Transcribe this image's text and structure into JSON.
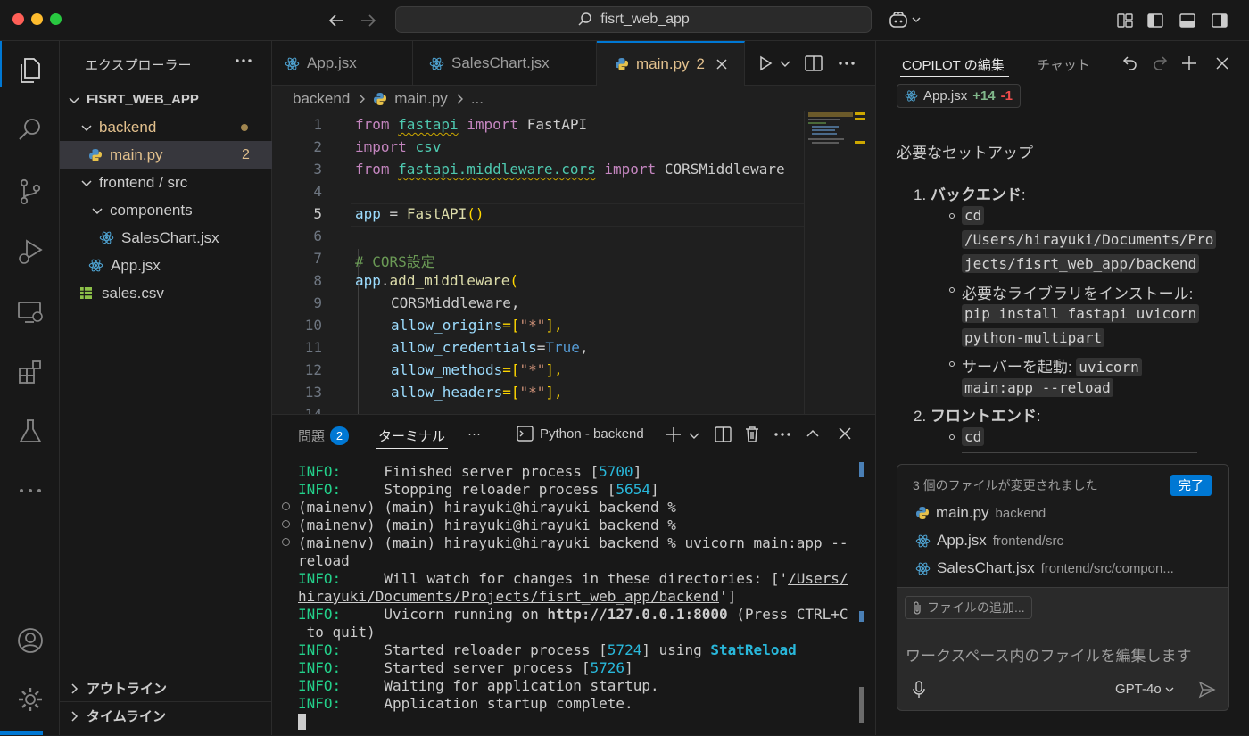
{
  "window": {
    "search_text": "fisrt_web_app"
  },
  "explorer": {
    "title": "エクスプローラー",
    "root": "FISRT_WEB_APP",
    "items": [
      {
        "label": "backend"
      },
      {
        "label": "main.py",
        "badge": "2"
      },
      {
        "label": "frontend / src"
      },
      {
        "label": "components"
      },
      {
        "label": "SalesChart.jsx"
      },
      {
        "label": "App.jsx"
      },
      {
        "label": "sales.csv"
      }
    ],
    "outline": "アウトライン",
    "timeline": "タイムライン"
  },
  "editor": {
    "tabs": [
      {
        "label": "App.jsx"
      },
      {
        "label": "SalesChart.jsx"
      },
      {
        "label": "main.py",
        "badge": "2"
      }
    ],
    "breadcrumb": [
      "backend",
      "main.py",
      "..."
    ],
    "line_numbers": [
      "1",
      "2",
      "3",
      "4",
      "5",
      "6",
      "7",
      "8",
      "9",
      "10",
      "11",
      "12",
      "13"
    ],
    "code": {
      "l1": [
        "from",
        "fastapi",
        "import",
        "FastAPI"
      ],
      "l2": [
        "import",
        "csv"
      ],
      "l3": [
        "from",
        "fastapi.middleware.cors",
        "import",
        "CORSMiddleware"
      ],
      "l5": [
        "app",
        " = ",
        "FastAPI",
        "()"
      ],
      "l7": "# CORS設定",
      "l8": [
        "app",
        ".",
        "add_middleware",
        "("
      ],
      "l9": "CORSMiddleware,",
      "l10": [
        "allow_origins",
        "=[",
        "\"*\"",
        "],"
      ],
      "l11": [
        "allow_credentials",
        "=",
        "True",
        ","
      ],
      "l12": [
        "allow_methods",
        "=[",
        "\"*\"",
        "],"
      ],
      "l13": [
        "allow_headers",
        "=[",
        "\"*\"",
        "],"
      ]
    }
  },
  "panel": {
    "problems_label": "問題",
    "problems_count": "2",
    "terminal_label": "ターミナル",
    "more": "···",
    "shell_label": "Python - backend",
    "lines": {
      "t1": [
        "INFO:",
        "     Finished server process [",
        "5700",
        "]"
      ],
      "t2": [
        "INFO:",
        "     Stopping reloader process [",
        "5654",
        "]"
      ],
      "t3": "(mainenv) (main) hirayuki@hirayuki backend %",
      "t4": "(mainenv) (main) hirayuki@hirayuki backend %",
      "t5": "(mainenv) (main) hirayuki@hirayuki backend % uvicorn main:app --",
      "t6": "reload",
      "t7": [
        "INFO:",
        "     Will watch for changes in these directories: ['",
        "/Users/"
      ],
      "t8": [
        "hirayuki/Documents/Projects/fisrt_web_app/backend",
        "']"
      ],
      "t9": [
        "INFO:",
        "     Uvicorn running on ",
        "http://127.0.0.1:8000",
        " (Press CTRL+C"
      ],
      "t10": " to quit)",
      "t11": [
        "INFO:",
        "     Started reloader process [",
        "5724",
        "] using ",
        "StatReload"
      ],
      "t12": [
        "INFO:",
        "     Started server process [",
        "5726",
        "]"
      ],
      "t13": [
        "INFO:",
        "     Waiting for application startup."
      ],
      "t14": [
        "INFO:",
        "     Application startup complete."
      ]
    }
  },
  "chat": {
    "tab_edit": "COPILOT の編集",
    "tab_chat": "チャット",
    "file_chip": {
      "name": "App.jsx",
      "added": "+14",
      "removed": "-1"
    },
    "heading": "必要なセットアップ",
    "step1": {
      "num": "1.",
      "title": "バックエンド",
      "colon": ":"
    },
    "cmd_cd1": "cd",
    "cmd_path1": "/Users/hirayuki/Documents/Pro",
    "cmd_path2": "jects/fisrt_web_app/backend",
    "lib_text": "必要なライブラリをインストール:",
    "pip1": "pip install fastapi uvicorn",
    "pip2": "python-multipart",
    "server_text": "サーバーを起動:",
    "uv1": "uvicorn",
    "uv2": "main:app --reload",
    "step2": {
      "num": "2.",
      "title": "フロントエンド",
      "colon": ":"
    },
    "cmd_cd2": "cd",
    "changes": {
      "summary": "3 個のファイルが変更されました",
      "done": "完了",
      "files": [
        {
          "name": "main.py",
          "path": "backend"
        },
        {
          "name": "App.jsx",
          "path": "frontend/src"
        },
        {
          "name": "SalesChart.jsx",
          "path": "frontend/src/compon..."
        }
      ]
    },
    "input": {
      "attach": "ファイルの追加...",
      "placeholder": "ワークスペース内のファイルを編集します",
      "model": "GPT-4o"
    }
  }
}
